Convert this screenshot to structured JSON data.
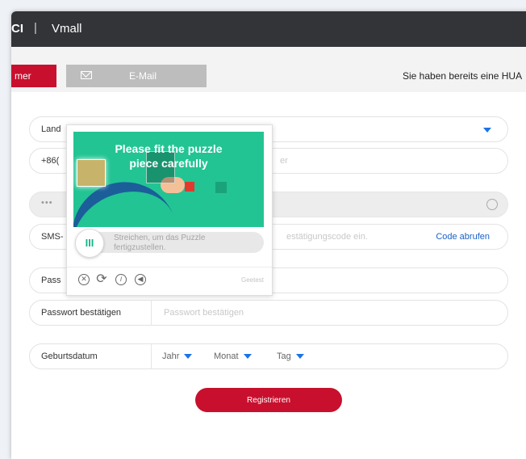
{
  "titlebar": {
    "logo": "CI",
    "separator": "|",
    "app_name": "Vmall"
  },
  "tabs": {
    "phone_label": "mer",
    "email_label": "E-Mail"
  },
  "login_hint": "Sie haben bereits eine HUA",
  "form": {
    "country_label": "Land",
    "phone_prefix": "+86(",
    "phone_placeholder": "er",
    "captcha_dots": "•••",
    "sms_label": "SMS-",
    "sms_placeholder": "estätigungscode ein.",
    "sms_code_link": "Code abrufen",
    "password_label": "Pass",
    "password_confirm_label": "Passwort bestätigen",
    "password_confirm_placeholder": "Passwort bestätigen",
    "birthdate_label": "Geburtsdatum",
    "year_label": "Jahr",
    "month_label": "Monat",
    "day_label": "Tag",
    "submit_label": "Registrieren"
  },
  "captcha": {
    "title_line1": "Please fit the puzzle",
    "title_line2": "piece carefully",
    "slider_handle_text": "III",
    "slider_hint": "Streichen, um das Puzzle fertigzustellen.",
    "brand": "Geetest",
    "icons": [
      "close-icon",
      "refresh-icon",
      "info-icon",
      "audio-icon"
    ]
  },
  "colors": {
    "accent_red": "#c8102e",
    "link_blue": "#1a62c7",
    "captcha_green": "#22c493"
  }
}
